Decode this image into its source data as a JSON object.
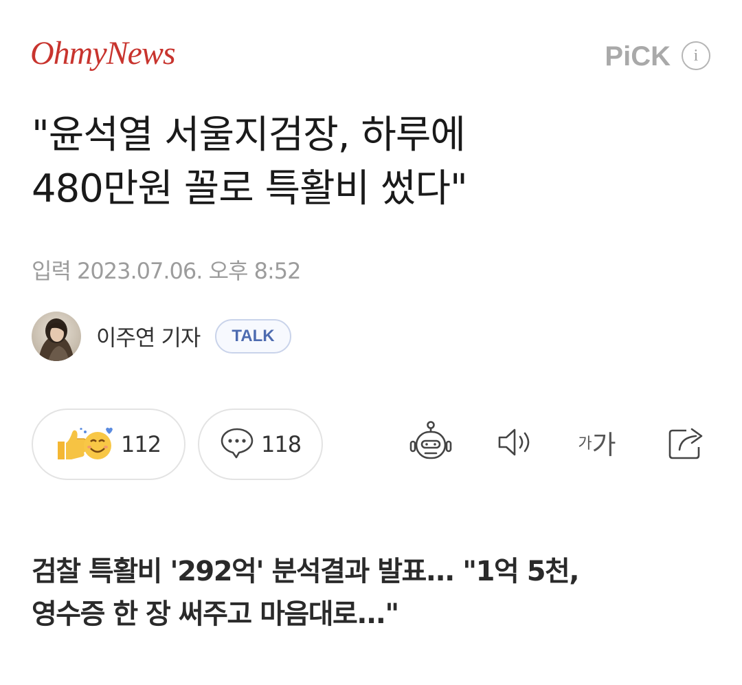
{
  "header": {
    "logo": "OhmyNews",
    "pick_label": "PiCK",
    "info_glyph": "i"
  },
  "article": {
    "headline_line1": "\"윤석열 서울지검장, 하루에",
    "headline_line2": "480만원 꼴로 특활비 썼다\"",
    "dateline": "입력 2023.07.06. 오후 8:52",
    "author": "이주연 기자",
    "talk_label": "TALK",
    "subheading_line1": "검찰 특활비 '292억' 분석결과 발표... \"1억 5천,",
    "subheading_line2": "영수증 한 장 써주고 마음대로...\""
  },
  "actions": {
    "reaction_count": "112",
    "comment_count": "118",
    "font_size_small": "가",
    "font_size_big": "가"
  },
  "icons": {
    "reaction": "thumbs-up-and-smile-emoji-icon",
    "comment": "speech-bubble-icon",
    "summary_bot": "robot-icon",
    "tts": "speaker-icon",
    "font_size": "font-size-icon",
    "share": "share-icon"
  },
  "colors": {
    "logo": "#c8342e",
    "pick": "#a9a9a9",
    "talk_text": "#4d6bb0",
    "dateline": "#9c9c9c"
  }
}
